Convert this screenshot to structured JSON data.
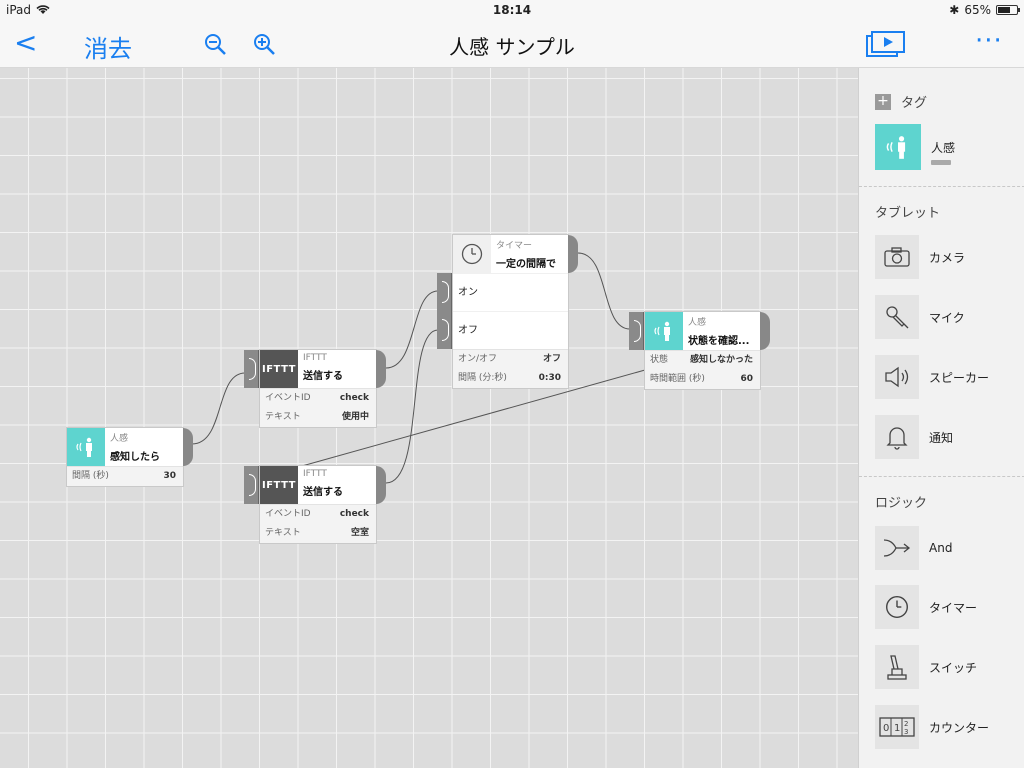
{
  "status_bar": {
    "device": "iPad",
    "time": "18:14",
    "battery": "65%"
  },
  "nav": {
    "back": "<",
    "clear": "消去",
    "title": "人感 サンプル",
    "more": "···"
  },
  "nodes": {
    "sensor": {
      "category": "人感",
      "title": "感知したら",
      "props": [
        {
          "label": "間隔 (秒)",
          "value": "30"
        }
      ]
    },
    "ifttt1": {
      "icon_text": "IFTTT",
      "category": "IFTTT",
      "title": "送信する",
      "props": [
        {
          "label": "イベントID",
          "value": "check"
        },
        {
          "label": "テキスト",
          "value": "使用中"
        }
      ]
    },
    "ifttt2": {
      "icon_text": "IFTTT",
      "category": "IFTTT",
      "title": "送信する",
      "props": [
        {
          "label": "イベントID",
          "value": "check"
        },
        {
          "label": "テキスト",
          "value": "空室"
        }
      ]
    },
    "timer": {
      "category": "タイマー",
      "title": "一定の間隔で",
      "row_on": "オン",
      "row_off": "オフ",
      "props": [
        {
          "label": "オン/オフ",
          "value": "オフ"
        },
        {
          "label": "間隔 (分:秒)",
          "value": "0:30"
        }
      ]
    },
    "check": {
      "category": "人感",
      "title": "状態を確認...",
      "props": [
        {
          "label": "状態",
          "value": "感知しなかった"
        },
        {
          "label": "時間範囲 (秒)",
          "value": "60"
        }
      ]
    }
  },
  "sidebar": {
    "tag_section": "タグ",
    "tag_item": "人感",
    "tablet_section": "タブレット",
    "tablet_items": [
      "カメラ",
      "マイク",
      "スピーカー",
      "通知"
    ],
    "logic_section": "ロジック",
    "logic_items": [
      "And",
      "タイマー",
      "スイッチ",
      "カウンター"
    ]
  },
  "colors": {
    "accent": "#1a7ff0",
    "teal": "#5ed4cf",
    "ifttt": "#555555"
  }
}
